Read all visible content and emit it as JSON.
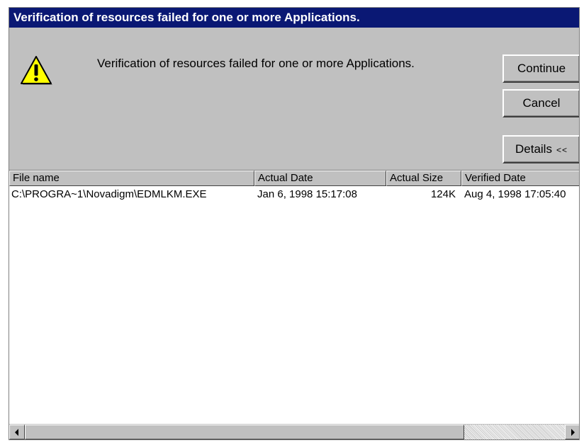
{
  "window": {
    "title": "Verification of resources failed for one or more Applications."
  },
  "dialog": {
    "message": "Verification of resources failed for one or more Applications.",
    "icon": "warning-icon"
  },
  "buttons": {
    "continue_label": "Continue",
    "cancel_label": "Cancel",
    "details_label": "Details",
    "details_chevron": "<<"
  },
  "list": {
    "columns": [
      "File name",
      "Actual Date",
      "Actual Size",
      "Verified Date"
    ],
    "rows": [
      {
        "file_name": "C:\\PROGRA~1\\Novadigm\\EDMLKM.EXE",
        "actual_date": "Jan 6, 1998 15:17:08",
        "actual_size": "124K",
        "verified_date": "Aug 4, 1998 17:05:40"
      }
    ]
  },
  "colors": {
    "title_bar": "#0a1874",
    "face": "#c0c0c0",
    "warning_fill": "#ffff00"
  }
}
